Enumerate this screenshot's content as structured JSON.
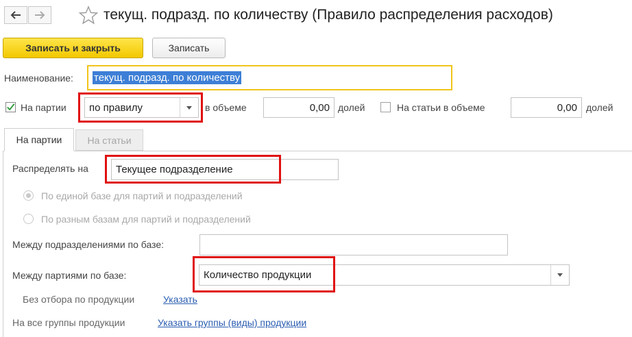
{
  "window": {
    "title": "текущ. подразд. по количеству (Правило распределения расходов)"
  },
  "toolbar": {
    "save_close_label": "Записать и закрыть",
    "save_label": "Записать"
  },
  "form": {
    "name_label": "Наименование:",
    "name_value": "текущ. подразд. по количеству",
    "on_batches_label": "На партии",
    "on_batches_checked": true,
    "on_batches_mode": "по правилу",
    "in_volume_label": "в объеме",
    "batches_volume_value": "0,00",
    "shares_label": "долей",
    "on_articles_label": "На статьи в объеме",
    "on_articles_checked": false,
    "articles_volume_value": "0,00",
    "shares_label2": "долей"
  },
  "tabs": [
    {
      "label": "На партии",
      "active": true
    },
    {
      "label": "На статьи",
      "active": false
    }
  ],
  "panel": {
    "distribute_label": "Распределять на",
    "distribute_value": "Текущее подразделение",
    "radio_single_label": "По единой базе для партий и подразделений",
    "radio_multi_label": "По разным базам для партий и подразделений",
    "between_divisions_label": "Между подразделениями по базе:",
    "between_divisions_value": "",
    "between_batches_label": "Между партиями по базе:",
    "between_batches_value": "Количество продукции",
    "no_filter_label": "Без отбора по продукции",
    "no_filter_link": "Указать",
    "all_groups_label": "На все группы продукции",
    "all_groups_link": "Указать группы (виды) продукции"
  },
  "colors": {
    "primary_button": "#f3c800",
    "highlight_border": "#e01010",
    "focus_border": "#f0c419",
    "link": "#2a5db0",
    "checkbox_check": "#2e9b3a"
  }
}
